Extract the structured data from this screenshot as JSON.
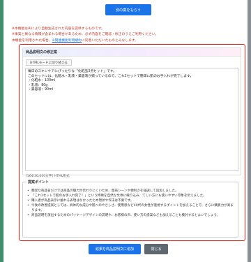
{
  "top_button": "別の案をもらう",
  "notes": {
    "line1": "※本機能はAIにより自動生成された内容を提供するものです。",
    "line2": "※事実と異なる情報が含まれる場合があるため、必ず内容をご確認・修正のうえご利用ください。",
    "line3_prefix": "本機能を利用された場合、",
    "line3_link": "※関連機能利用規約",
    "line3_suffix": "に同意いただいたものとみなします。"
  },
  "panel": {
    "header": "商品説明文の修正案",
    "mode_button": "HTMLモードに切り替える",
    "editor_lines": [
      "毎日のスキンケアにぴったりな「化粧品3点セット」です。",
      "このセットには、化粧水・乳液・美容液が揃っているので、これ1セットで簡単に肌のお手入れが完了します。",
      "・化粧水：100ml",
      "・乳液：80g",
      "・美容液：90ml"
    ],
    "counter": "[164/30,000文字] HTML形式"
  },
  "suggest": {
    "title": "提案ポイント",
    "items": [
      "簡潔な商品名だけでは商品の魅力が伝わりにくいため、発売シーンや便利さを強調して追加しました。",
      "「これ1セットで肌のお手入れ完了！」という特徴を自然な文章に織り込み、てしい方にも使いやすい印象を伝えました。",
      "購入者が商品表示に触れる表現はなかったため現状や作法は不要です。",
      "今後の改善提案としては、具体的な成分や肌へのやさしさ、使用感など40代の女性が重視するポイントを加えることで、さらに購買力が高まります。",
      "商品説明を演出するためのパッケージデザインの説明や、お客様の声、使い方の提案なども加えることも検討するとよいでしょう。"
    ]
  },
  "footer": {
    "add_button": "結果を商品説明文に追加",
    "close_button": "閉じる"
  },
  "colors": {
    "primary": "#1a73e8",
    "highlight_border": "#e2231a",
    "warning_text": "#c0392b",
    "close_button": "#5f6770"
  }
}
